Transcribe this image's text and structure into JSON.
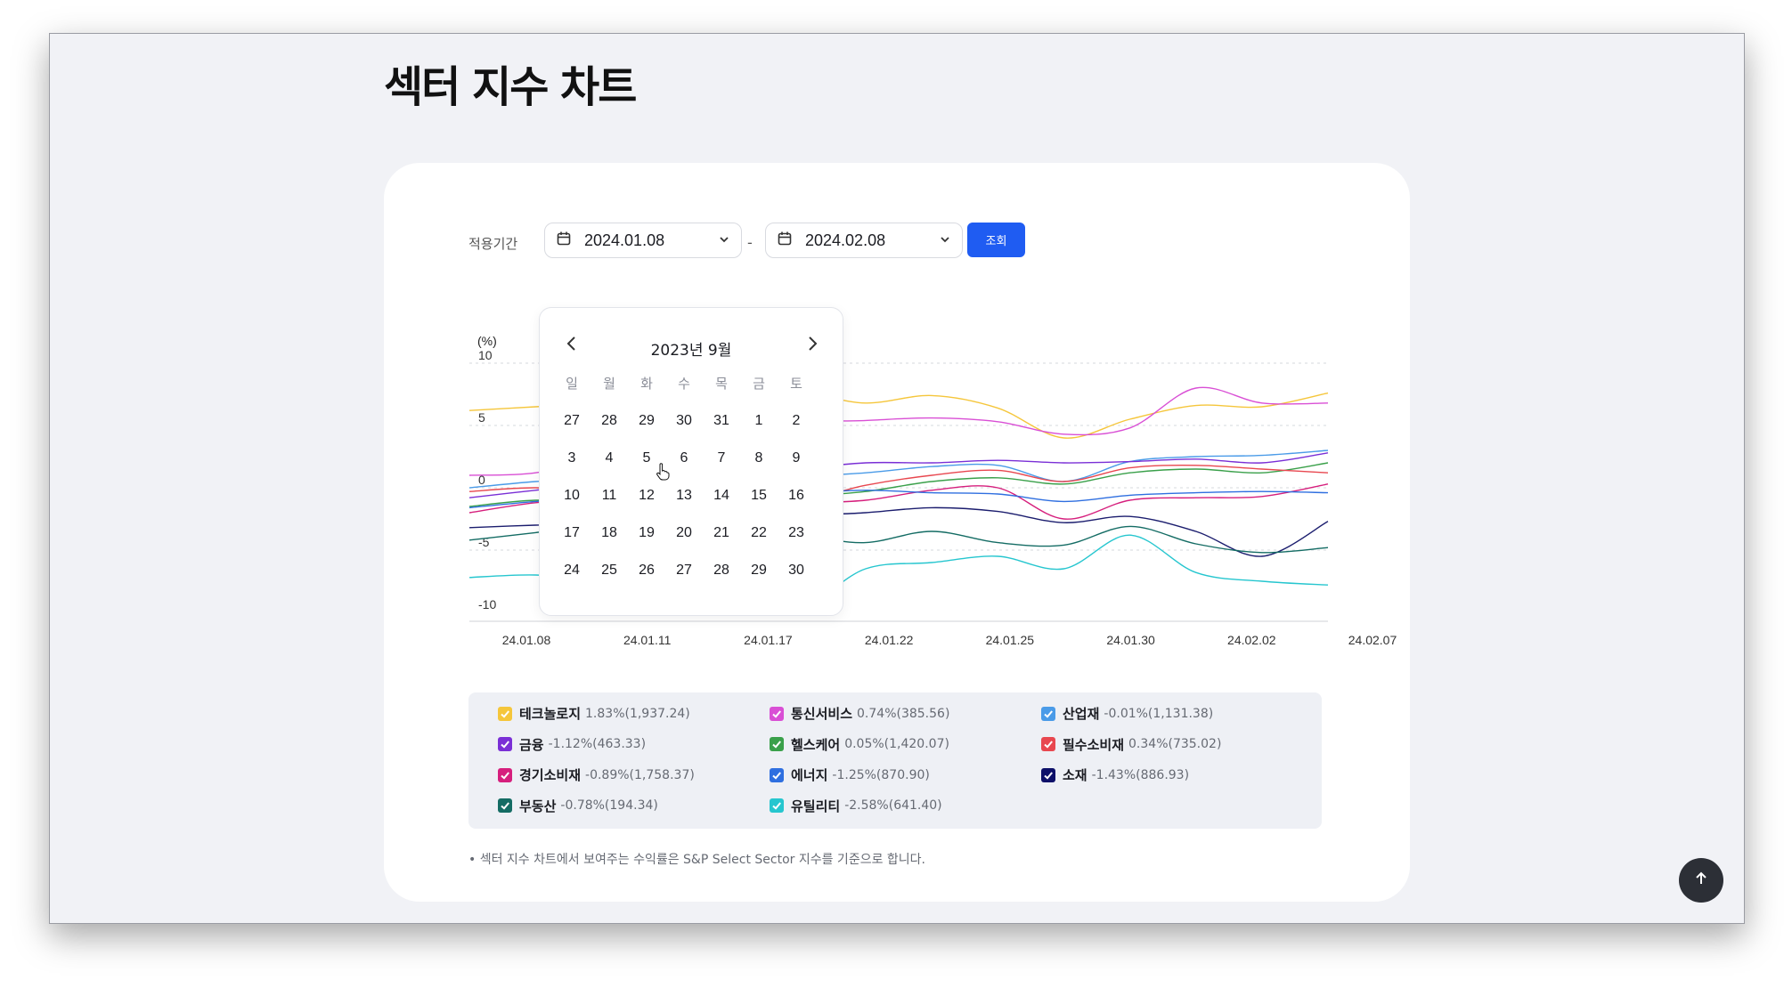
{
  "page": {
    "title": "섹터 지수 차트"
  },
  "filter": {
    "period_label": "적용기간",
    "start_date": "2024.01.08",
    "end_date": "2024.02.08",
    "separator": "-",
    "query_button": "조회"
  },
  "datepicker": {
    "month_label": "2023년 9월",
    "weekdays": [
      "일",
      "월",
      "화",
      "수",
      "목",
      "금",
      "토"
    ],
    "weeks": [
      [
        "27",
        "28",
        "29",
        "30",
        "31",
        "1",
        "2"
      ],
      [
        "3",
        "4",
        "5",
        "6",
        "7",
        "8",
        "9"
      ],
      [
        "10",
        "11",
        "12",
        "13",
        "14",
        "15",
        "16"
      ],
      [
        "17",
        "18",
        "19",
        "20",
        "21",
        "22",
        "23"
      ],
      [
        "24",
        "25",
        "26",
        "27",
        "28",
        "29",
        "30"
      ]
    ]
  },
  "chart_data": {
    "type": "line",
    "ylabel": "(%)",
    "ylim": [
      -10,
      10
    ],
    "y_ticks": [
      "10",
      "5",
      "0",
      "-5",
      "-10"
    ],
    "x_ticks": [
      "24.01.08",
      "24.01.11",
      "24.01.17",
      "24.01.22",
      "24.01.25",
      "24.01.30",
      "24.02.02",
      "24.02.07"
    ],
    "grid": "horizontal-dashed",
    "series": [
      {
        "name": "테크놀로지",
        "color": "#f5c63b",
        "values": [
          6.2,
          6.5,
          6.8,
          7.2,
          7.0,
          7.6,
          6.8,
          7.4,
          6.4,
          4.0,
          5.5,
          6.6,
          6.5,
          7.6
        ]
      },
      {
        "name": "통신서비스",
        "color": "#d94fd5",
        "values": [
          1.0,
          1.2,
          2.5,
          3.6,
          4.2,
          5.2,
          5.4,
          5.6,
          5.3,
          4.3,
          4.8,
          8.0,
          6.8,
          6.8
        ]
      },
      {
        "name": "산업재",
        "color": "#4a9be8",
        "values": [
          0.0,
          0.5,
          0.8,
          0.2,
          0.6,
          0.9,
          1.2,
          1.7,
          1.8,
          0.5,
          2.1,
          2.5,
          2.6,
          3.0
        ]
      },
      {
        "name": "금융",
        "color": "#7a2fd6",
        "values": [
          -0.8,
          -0.2,
          0.3,
          0.5,
          0.8,
          1.5,
          2.0,
          2.0,
          2.2,
          2.0,
          2.1,
          2.3,
          2.0,
          2.8
        ]
      },
      {
        "name": "헬스케어",
        "color": "#3aa04a",
        "values": [
          -1.5,
          -1.0,
          -1.2,
          -1.6,
          -0.9,
          -0.7,
          -0.3,
          0.5,
          0.8,
          0.3,
          1.2,
          1.5,
          1.2,
          2.0
        ]
      },
      {
        "name": "필수소비재",
        "color": "#e8474f",
        "values": [
          -0.3,
          0.0,
          -0.4,
          -1.0,
          -0.5,
          -1.0,
          0.2,
          1.0,
          1.4,
          0.5,
          1.6,
          1.8,
          1.5,
          1.2
        ]
      },
      {
        "name": "경기소비재",
        "color": "#d61f7d",
        "values": [
          -2.0,
          -1.2,
          -0.9,
          -1.5,
          -2.0,
          -1.3,
          -1.0,
          -0.2,
          0.0,
          -2.5,
          -1.0,
          -0.8,
          -0.7,
          0.3
        ]
      },
      {
        "name": "에너지",
        "color": "#2f6fe0",
        "values": [
          -1.6,
          -1.1,
          -0.8,
          -0.6,
          -1.2,
          -0.5,
          -0.2,
          -0.4,
          -0.5,
          -1.1,
          -0.6,
          -0.4,
          -0.3,
          -0.4
        ]
      },
      {
        "name": "소재",
        "color": "#1b1d6e",
        "values": [
          -3.2,
          -3.0,
          -2.9,
          -3.3,
          -3.0,
          -2.3,
          -2.0,
          -1.6,
          -1.9,
          -2.8,
          -2.3,
          -3.5,
          -5.5,
          -2.7
        ]
      },
      {
        "name": "부동산",
        "color": "#146c64",
        "values": [
          -4.2,
          -3.6,
          -3.0,
          -3.4,
          -5.0,
          -4.0,
          -4.4,
          -3.5,
          -4.4,
          -4.6,
          -3.1,
          -4.5,
          -5.2,
          -4.8
        ]
      },
      {
        "name": "유틸리티",
        "color": "#26c6cf",
        "values": [
          -7.2,
          -7.0,
          -7.5,
          -8.0,
          -7.6,
          -9.5,
          -6.5,
          -6.0,
          -5.5,
          -6.5,
          -3.8,
          -6.8,
          -7.5,
          -7.8
        ]
      }
    ]
  },
  "legend": [
    {
      "name": "테크놀로지",
      "value": "1.83%(1,937.24)",
      "color": "#f5c63b"
    },
    {
      "name": "통신서비스",
      "value": "0.74%(385.56)",
      "color": "#d94fd5"
    },
    {
      "name": "산업재",
      "value": "-0.01%(1,131.38)",
      "color": "#4a9be8"
    },
    {
      "name": "금융",
      "value": "-1.12%(463.33)",
      "color": "#7a2fd6"
    },
    {
      "name": "헬스케어",
      "value": "0.05%(1,420.07)",
      "color": "#3aa04a"
    },
    {
      "name": "필수소비재",
      "value": "0.34%(735.02)",
      "color": "#e8474f"
    },
    {
      "name": "경기소비재",
      "value": "-0.89%(1,758.37)",
      "color": "#d61f7d"
    },
    {
      "name": "에너지",
      "value": "-1.25%(870.90)",
      "color": "#2f6fe0"
    },
    {
      "name": "소재",
      "value": "-1.43%(886.93)",
      "color": "#0d1069"
    },
    {
      "name": "부동산",
      "value": "-0.78%(194.34)",
      "color": "#146c64"
    },
    {
      "name": "유틸리티",
      "value": "-2.58%(641.40)",
      "color": "#26c6cf"
    }
  ],
  "footnote": "섹터 지수 차트에서 보여주는 수익률은 S&P Select Sector 지수를 기준으로 합니다.",
  "icons": {
    "calendar": "calendar-icon",
    "chevron": "chevron-down-icon",
    "prev": "chevron-left-icon",
    "next": "chevron-right-icon",
    "top": "arrow-up-icon"
  }
}
